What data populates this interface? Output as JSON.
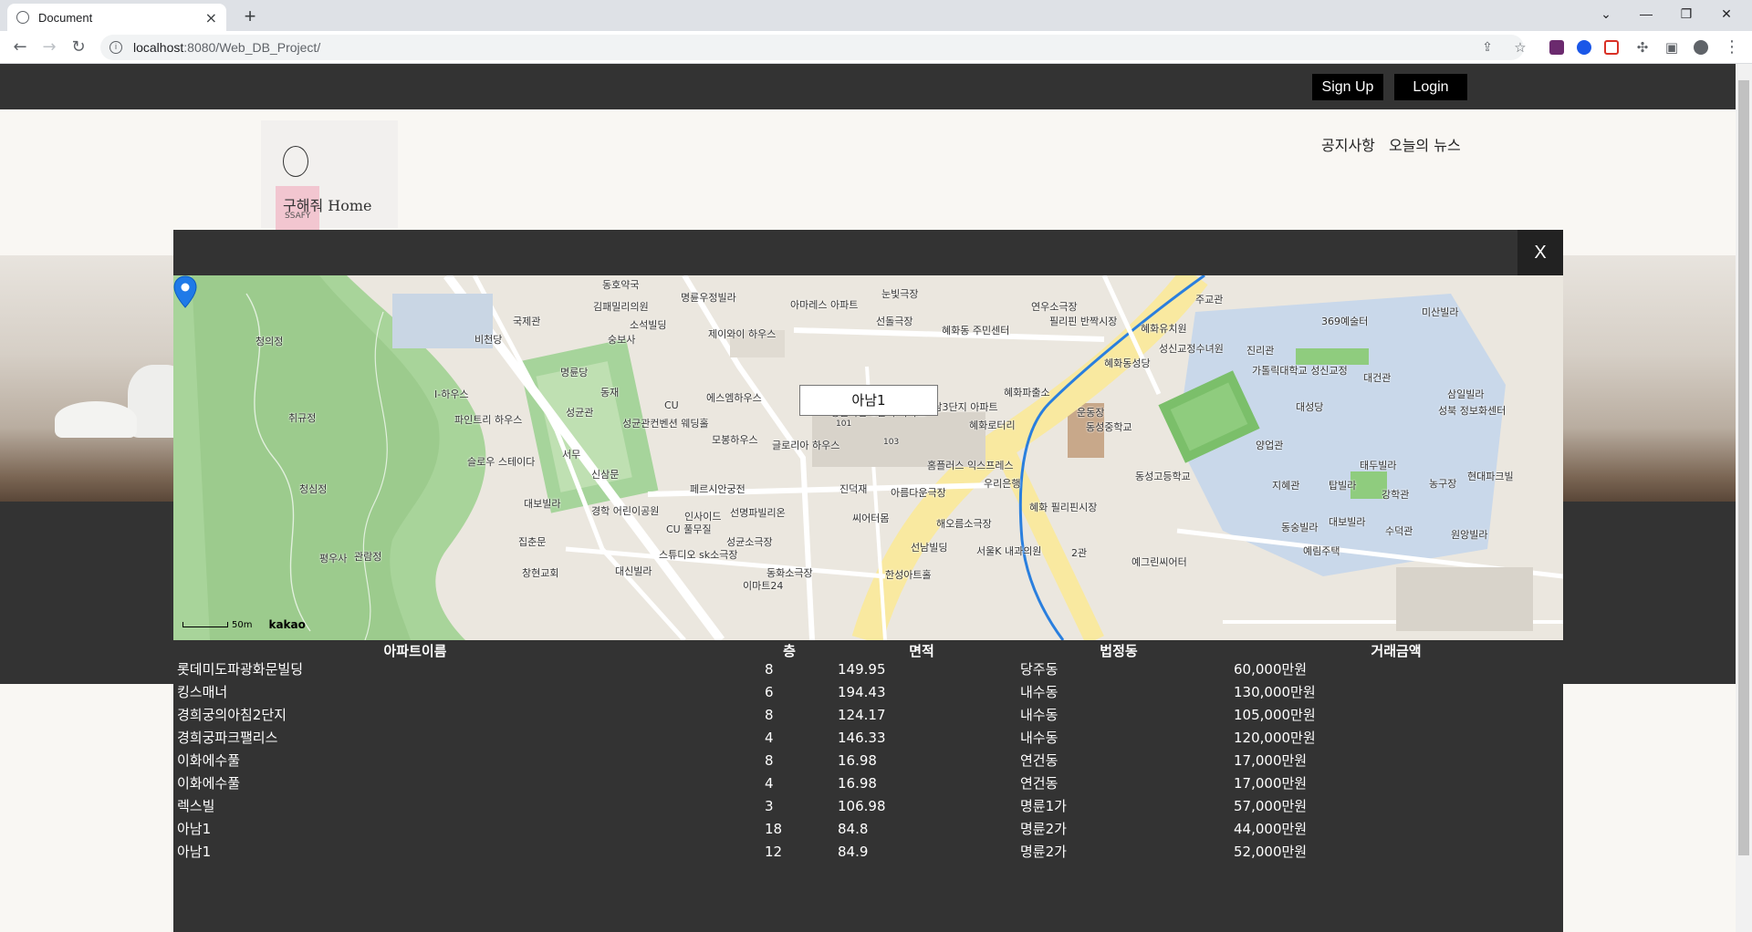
{
  "browser": {
    "tab_title": "Document",
    "tab_close": "×",
    "new_tab": "+",
    "url_host": "localhost",
    "url_rest": ":8080/Web_DB_Project/",
    "win_minimize": "—",
    "win_restore": "❐",
    "win_close": "✕",
    "tab_list": "⌄"
  },
  "nav": {
    "signup_label": "Sign Up",
    "login_label": "Login"
  },
  "header": {
    "logo_text": "구해줘 Home",
    "logo_sub": "SSAFY",
    "links": [
      "공지사항",
      "오늘의 뉴스"
    ]
  },
  "modal": {
    "close_label": "X",
    "map": {
      "infowindow_label": "아남1",
      "scale_label": "50m",
      "provider": "kakao",
      "labels": [
        {
          "t": "동호약국"
        },
        {
          "t": "김패밀리의원"
        },
        {
          "t": "명륜우정빌라"
        },
        {
          "t": "아마레스 아파트"
        },
        {
          "t": "눈빛극장"
        },
        {
          "t": "선돌극장"
        },
        {
          "t": "혜화동 주민센터"
        },
        {
          "t": "연우소극장"
        },
        {
          "t": "필리핀 반짝시장"
        },
        {
          "t": "주교관"
        },
        {
          "t": "혜화유치원"
        },
        {
          "t": "369예술터"
        },
        {
          "t": "미산빌라"
        },
        {
          "t": "국제관"
        },
        {
          "t": "소석빌딩"
        },
        {
          "t": "제이와이 하우스"
        },
        {
          "t": "청의정"
        },
        {
          "t": "비천당"
        },
        {
          "t": "숭보사"
        },
        {
          "t": "명륜당"
        },
        {
          "t": "성신교정수녀원"
        },
        {
          "t": "진리관"
        },
        {
          "t": "가톨릭대학교 성신교정"
        },
        {
          "t": "대건관"
        },
        {
          "t": "혜화동성당"
        },
        {
          "t": "I-하우스"
        },
        {
          "t": "동재"
        },
        {
          "t": "에스엠하우스"
        },
        {
          "t": "혜화파출소"
        },
        {
          "t": "삼일빌라"
        },
        {
          "t": "성북 정보화센터"
        },
        {
          "t": "취규정"
        },
        {
          "t": "파인트리 하우스"
        },
        {
          "t": "성균관"
        },
        {
          "t": "성균관컨벤션 웨딩홀"
        },
        {
          "t": "CU"
        },
        {
          "t": "명륜아남 1단지 아파트"
        },
        {
          "t": "명륜아남3단지 아파트"
        },
        {
          "t": "혜화로터리"
        },
        {
          "t": "운동장"
        },
        {
          "t": "동성중학교"
        },
        {
          "t": "대성당"
        },
        {
          "t": "모봉하우스"
        },
        {
          "t": "글로리아 하우스"
        },
        {
          "t": "양업관"
        },
        {
          "t": "슬로우 스테이다"
        },
        {
          "t": "서무"
        },
        {
          "t": "신삼문"
        },
        {
          "t": "홈플러스 익스프레스"
        },
        {
          "t": "우리은행"
        },
        {
          "t": "동성고등학교"
        },
        {
          "t": "태두빌라"
        },
        {
          "t": "현대파크빌"
        },
        {
          "t": "청심정"
        },
        {
          "t": "페르시안궁전"
        },
        {
          "t": "진덕재"
        },
        {
          "t": "아름다운극장"
        },
        {
          "t": "지혜관"
        },
        {
          "t": "탑빌라"
        },
        {
          "t": "농구장"
        },
        {
          "t": "대보빌라"
        },
        {
          "t": "경학 어린이공원"
        },
        {
          "t": "인사이드"
        },
        {
          "t": "선명파빌리온"
        },
        {
          "t": "씨어터몸"
        },
        {
          "t": "해오름소극장"
        },
        {
          "t": "혜화 필리핀시장"
        },
        {
          "t": "강학관"
        },
        {
          "t": "동숭빌라"
        },
        {
          "t": "대보빌라"
        },
        {
          "t": "수덕관"
        },
        {
          "t": "원앙빌라"
        },
        {
          "t": "집춘문"
        },
        {
          "t": "CU 풀무질"
        },
        {
          "t": "성균소극장"
        },
        {
          "t": "선남빌딩"
        },
        {
          "t": "서울K 내과의원"
        },
        {
          "t": "2관"
        },
        {
          "t": "예림주택"
        },
        {
          "t": "평우사"
        },
        {
          "t": "관람정"
        },
        {
          "t": "스튜디오 sk소극장"
        },
        {
          "t": "대신빌라"
        },
        {
          "t": "창현교회"
        },
        {
          "t": "동화소극장"
        },
        {
          "t": "이마트24"
        },
        {
          "t": "한성아트홀"
        },
        {
          "t": "예그린씨어터"
        },
        {
          "t": "101"
        },
        {
          "t": "102"
        },
        {
          "t": "103"
        }
      ]
    },
    "table": {
      "headers": [
        "아파트이름",
        "층",
        "면적",
        "법정동",
        "거래금액"
      ],
      "rows": [
        [
          "롯데미도파광화문빌딩",
          "8",
          "149.95",
          "당주동",
          "60,000만원"
        ],
        [
          "킹스매너",
          "6",
          "194.43",
          "내수동",
          "130,000만원"
        ],
        [
          "경희궁의아침2단지",
          "8",
          "124.17",
          "내수동",
          "105,000만원"
        ],
        [
          "경희궁파크팰리스",
          "4",
          "146.33",
          "내수동",
          "120,000만원"
        ],
        [
          "이화에수풀",
          "8",
          "16.98",
          "연건동",
          "17,000만원"
        ],
        [
          "이화에수풀",
          "4",
          "16.98",
          "연건동",
          "17,000만원"
        ],
        [
          "렉스빌",
          "3",
          "106.98",
          "명륜1가",
          "57,000만원"
        ],
        [
          "아남1",
          "18",
          "84.8",
          "명륜2가",
          "44,000만원"
        ],
        [
          "아남1",
          "12",
          "84.9",
          "명륜2가",
          "52,000만원"
        ]
      ]
    }
  }
}
